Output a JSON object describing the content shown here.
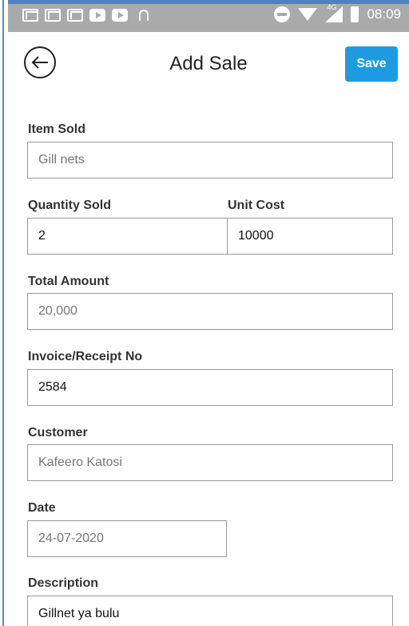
{
  "status_bar": {
    "time": "08:09",
    "network_label": "4G"
  },
  "header": {
    "title": "Add Sale",
    "save_label": "Save"
  },
  "form": {
    "item_sold": {
      "label": "Item Sold",
      "value": "Gill nets"
    },
    "quantity_sold": {
      "label": "Quantity Sold",
      "value": "2"
    },
    "unit_cost": {
      "label": "Unit Cost",
      "value": "10000"
    },
    "total_amount": {
      "label": "Total Amount",
      "value": "20,000"
    },
    "invoice_no": {
      "label": "Invoice/Receipt No",
      "value": "2584"
    },
    "customer": {
      "label": "Customer",
      "value": "Kafeero Katosi"
    },
    "date": {
      "label": "Date",
      "value": "24-07-2020"
    },
    "description": {
      "label": "Description",
      "value": "Gillnet ya bulu"
    }
  },
  "colors": {
    "accent": "#1e9be0",
    "status_bar": "#aaaaaa"
  }
}
